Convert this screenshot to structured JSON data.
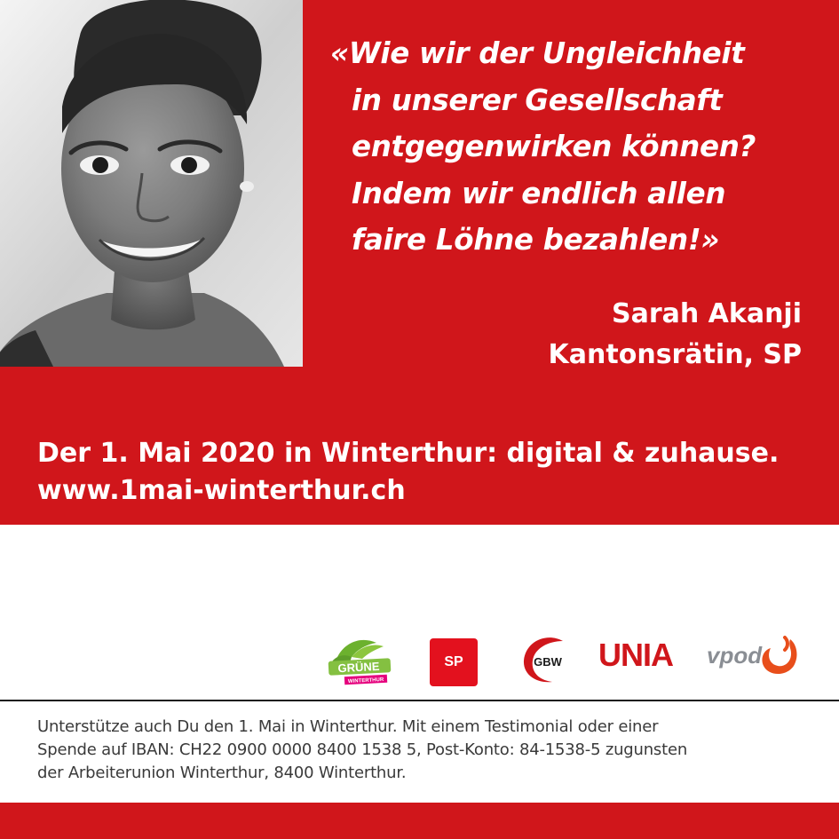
{
  "colors": {
    "brand_red": "#d0161b",
    "text_white": "#ffffff",
    "footer_text": "#3a3a3a"
  },
  "photo": {
    "subject": "portrait-photo"
  },
  "quote": {
    "lines": [
      "«Wie wir der Ungleichheit",
      "in unserer Gesellschaft",
      "entgegenwirken können?",
      "Indem wir endlich allen",
      "faire Löhne bezahlen!»"
    ]
  },
  "author": {
    "name": "Sarah Akanji",
    "role": "Kantonsrätin, SP"
  },
  "event": {
    "headline": "Der 1. Mai 2020 in Winterthur: digital & zuhause.",
    "url": "www.1mai-winterthur.ch"
  },
  "logos": {
    "gruene": {
      "text": "GRÜNE",
      "subtext": "WINTERTHUR"
    },
    "sp": "SP",
    "gbw": "GBW",
    "unia": "UNIA",
    "vpod": "vpod"
  },
  "support": {
    "lines": [
      "Unterstütze auch Du den 1. Mai in Winterthur. Mit einem Testimonial oder einer",
      "Spende auf IBAN: CH22 0900 0000 8400 1538 5, Post-Konto: 84-1538-5 zugunsten",
      "der Arbeiterunion Winterthur, 8400 Winterthur."
    ]
  }
}
